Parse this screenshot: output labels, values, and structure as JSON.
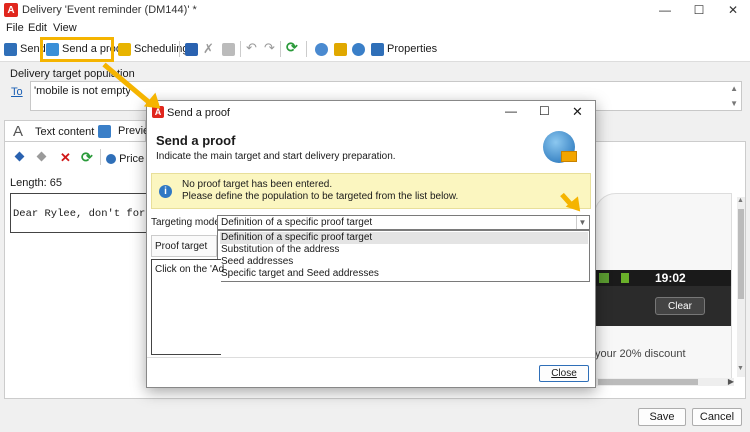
{
  "window": {
    "title": "Delivery 'Event reminder (DM144)' *"
  },
  "menu": [
    "File",
    "Edit",
    "View"
  ],
  "toolbar": {
    "send": "Send",
    "send_proof": "Send a proof",
    "scheduling": "Scheduling",
    "properties": "Properties"
  },
  "target": {
    "heading": "Delivery target population",
    "to_link": "To",
    "query": "'mobile is not empty'"
  },
  "tabs": {
    "text_content": "Text content",
    "preview": "Previe"
  },
  "editor": {
    "price_label": "Price R",
    "length_label": "Length:",
    "length_value": "65",
    "message": "Dear Rylee, don't forget"
  },
  "phone": {
    "time": "19:02",
    "clear": "Clear",
    "discount": "your 20% discount"
  },
  "footer": {
    "save": "Save",
    "cancel": "Cancel"
  },
  "dialog": {
    "window_title": "Send a proof",
    "heading": "Send a proof",
    "subtitle": "Indicate the main target and start delivery preparation.",
    "warning_line1": "No proof target has been entered.",
    "warning_line2": "Please define the population to be targeted from the list below.",
    "targeting_label": "Targeting mode:",
    "selected": "Definition of a specific proof target",
    "options": [
      "Definition of a specific proof target",
      "Substitution of the address",
      "Seed addresses",
      "Specific target and Seed addresses"
    ],
    "proof_target_label": "Proof target",
    "click_text": "Click on the 'Ad",
    "close": "Close"
  },
  "colors": {
    "accent": "#f5b400",
    "warning_bg": "#fbf6c0",
    "link": "#1a5fb4"
  }
}
